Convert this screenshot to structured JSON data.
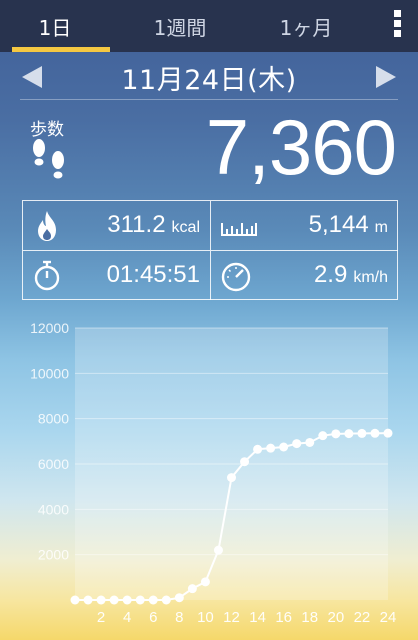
{
  "tabs": [
    {
      "label": "1日",
      "active": true
    },
    {
      "label": "1週間",
      "active": false
    },
    {
      "label": "1ヶ月",
      "active": false
    }
  ],
  "menu_icon": "vertical-dots-menu-icon",
  "date": {
    "label": "11月24日(木)",
    "prev_icon": "left-arrow-icon",
    "next_icon": "right-arrow-icon"
  },
  "steps": {
    "label": "歩数",
    "value": "7,360",
    "icon": "footprints-icon"
  },
  "stats": {
    "calories": {
      "value": "311.2",
      "unit": "kcal",
      "icon": "flame-icon"
    },
    "distance": {
      "value": "5,144",
      "unit": "m",
      "icon": "ruler-icon"
    },
    "duration": {
      "value": "01:45:51",
      "icon": "stopwatch-icon"
    },
    "speed": {
      "value": "2.9",
      "unit": "km/h",
      "icon": "speedometer-icon"
    }
  },
  "colors": {
    "tab_bar": "#28334e",
    "tab_underline": "#f5c842",
    "line": "#ffffff"
  },
  "chart_data": {
    "type": "line",
    "title": "",
    "xlabel": "",
    "ylabel": "",
    "ylim": [
      0,
      12000
    ],
    "yticks": [
      "12000",
      "10000",
      "8000",
      "6000",
      "4000",
      "2000"
    ],
    "xticks": [
      "2",
      "4",
      "6",
      "8",
      "10",
      "12",
      "14",
      "16",
      "18",
      "20",
      "22",
      "24"
    ],
    "grid": true,
    "x": [
      0,
      1,
      2,
      3,
      4,
      5,
      6,
      7,
      8,
      9,
      10,
      11,
      12,
      13,
      14,
      15,
      16,
      17,
      18,
      19,
      20,
      21,
      22,
      23,
      24
    ],
    "series": [
      {
        "values": [
          0,
          0,
          0,
          0,
          0,
          0,
          0,
          0,
          100,
          500,
          800,
          2200,
          5400,
          6100,
          6650,
          6700,
          6750,
          6900,
          6950,
          7250,
          7330,
          7340,
          7350,
          7355,
          7360
        ]
      }
    ]
  }
}
